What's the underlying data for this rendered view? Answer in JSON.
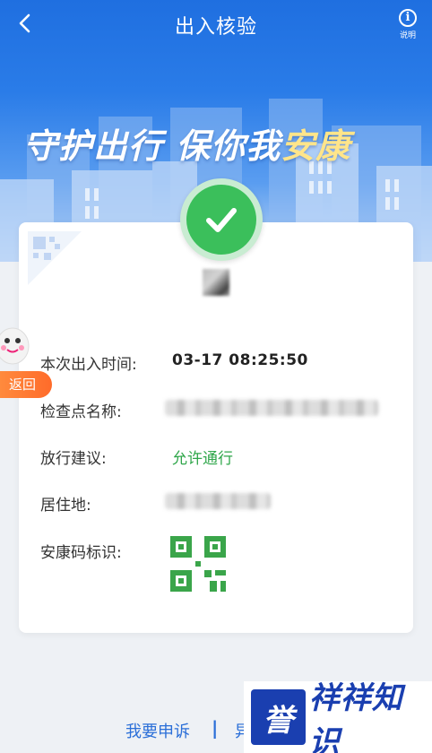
{
  "header": {
    "title": "出入核验",
    "help_label": "说明",
    "slogan_main": "守护出行 保你我",
    "slogan_accent": "安康"
  },
  "record": {
    "time_label": "本次出入时间:",
    "time_value": "03-17 08:25:50",
    "checkpoint_label": "检查点名称:",
    "advice_label": "放行建议:",
    "advice_value": "允许通行",
    "residence_label": "居住地:",
    "code_label": "安康码标识:"
  },
  "floating": {
    "return_label": "返回"
  },
  "footer": {
    "appeal_label": "我要申诉",
    "separator": "|",
    "other_label": "异"
  },
  "watermark": {
    "logo_char": "誉",
    "text": "祥祥知识"
  },
  "colors": {
    "primary": "#1f6fe0",
    "success": "#3bbf5b",
    "link": "#2b6fd8",
    "accent_orange": "#ff6b2a"
  }
}
